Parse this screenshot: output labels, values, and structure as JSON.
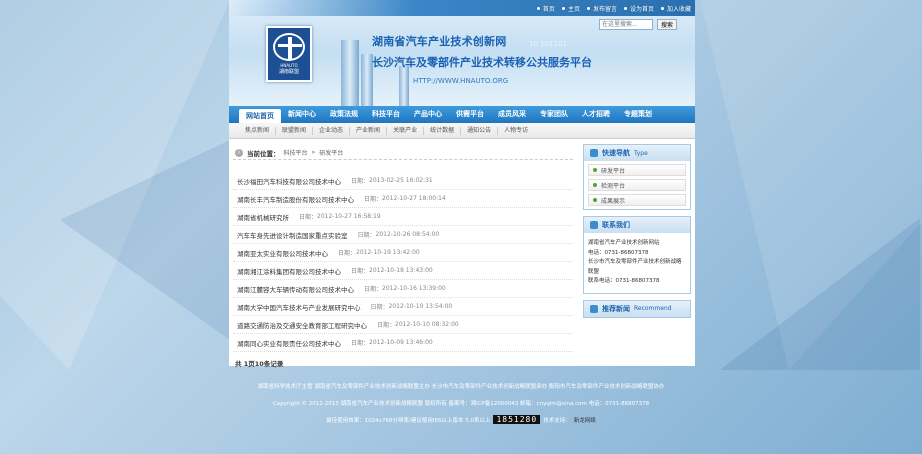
{
  "topbar": {
    "links": [
      "首页",
      "主页",
      "发布留言",
      "设为首页",
      "加入收藏"
    ]
  },
  "search": {
    "placeholder": "在这里搜索...",
    "button": "搜索"
  },
  "logo": {
    "en": "HNAUTO",
    "cn": "湖南联盟"
  },
  "header": {
    "title1": "湖南省汽车产业技术创新网",
    "title2": "长沙汽车及零部件产业技术转移公共服务平台",
    "url": "HTTP://WWW.HNAUTO.ORG",
    "faint": "10 101101"
  },
  "nav": {
    "items": [
      "网站首页",
      "新闻中心",
      "政策法规",
      "科技平台",
      "产品中心",
      "供需平台",
      "成员风采",
      "专家团队",
      "人才招聘",
      "专题策划"
    ]
  },
  "subnav": {
    "items": [
      "焦点新闻",
      "联盟新闻",
      "企业动态",
      "产业新闻",
      "关联产业",
      "统计数据",
      "通知公告",
      "人物专访"
    ]
  },
  "crumb": {
    "label": "当前位置：",
    "path1": "科技平台",
    "sep": "»",
    "path2": "研发平台"
  },
  "list": {
    "date_prefix": "日期：",
    "items": [
      {
        "title": "长沙福田汽车科技有限公司技术中心",
        "date": "2013-02-25 16:02:31"
      },
      {
        "title": "湖南长丰汽车制造股份有限公司技术中心",
        "date": "2012-10-27 18:00:14"
      },
      {
        "title": "湖南省机械研究所",
        "date": "2012-10-27 16:58:19"
      },
      {
        "title": "汽车车身先进设计制造国家重点实验室",
        "date": "2012-10-26 08:54:00"
      },
      {
        "title": "湖南亚太实业有限公司技术中心",
        "date": "2012-10-19 13:42:00"
      },
      {
        "title": "湖南湘江涂料集团有限公司技术中心",
        "date": "2012-10-18 13:43:00"
      },
      {
        "title": "湖南江麓容大车辆传动有限公司技术中心",
        "date": "2012-10-16 13:39:00"
      },
      {
        "title": "湖南大学中国汽车技术与产业发展研究中心",
        "date": "2012-10-10 13:54:00"
      },
      {
        "title": "道路交通防治及交通安全教育部工程研究中心",
        "date": "2012-10-10 08:32:00"
      },
      {
        "title": "湖南同心实业有限责任公司技术中心",
        "date": "2012-10-09 13:46:00"
      }
    ]
  },
  "pager": {
    "text": "共 1页10条记录"
  },
  "side": {
    "nav_title": "快速导航",
    "nav_en": "Type",
    "nav_items": [
      "研发平台",
      "检测平台",
      "成果展示"
    ],
    "contact_title": "联系我们",
    "contact_lines": [
      "湖南省汽车产业技术创新网站",
      "电话：0731-86807378",
      "长沙市汽车及零部件产业技术创新战略",
      "联盟",
      "联系电话：0731-86807378"
    ],
    "rec_title": "推荐新闻",
    "rec_en": "Recommend"
  },
  "footer": {
    "line1": "湖南省科学技术厅主管  湖南省汽车及零部件产业技术创新战略联盟主办  长沙市汽车及零部件产业技术创新战略联盟承办  衡阳市汽车及零部件产业技术创新战略联盟协办",
    "line2": "Copyright © 2012-2013  湖南省汽车产业技术创新战略联盟 版权所有  备案号：湘ICP备12000043 邮箱：cnyqlm@sina.com 电话：0731-86807378",
    "line3a": "最佳使用效果：1024x768分辨率/建议使用IE6以上版本 5.0系以上",
    "counter": "1851280",
    "line3b": "技术支持：",
    "tech": "新龙网络"
  }
}
